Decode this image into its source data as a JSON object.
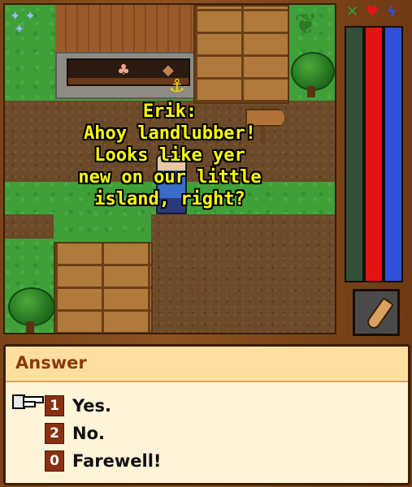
{
  "npc": {
    "name": "Erik:",
    "speech_lines": [
      "Ahoy landlubber!",
      "Looks like yer",
      "new on our little",
      "island, right?"
    ]
  },
  "status": {
    "icons": {
      "experience": "crossed-swords-icon",
      "health": "heart-icon",
      "mana": "lightning-icon"
    },
    "experience_fraction": 1.0,
    "health_fraction": 1.0,
    "mana_fraction": 1.0,
    "colors": {
      "experience": "#30503a",
      "health": "#e21414",
      "mana": "#3050d8"
    }
  },
  "weapon": {
    "icon": "club-icon"
  },
  "dialog": {
    "title": "Answer",
    "options": [
      {
        "key": "1",
        "label": "Yes.",
        "selected": true
      },
      {
        "key": "2",
        "label": "No."
      },
      {
        "key": "0",
        "label": "Farewell!"
      }
    ]
  }
}
